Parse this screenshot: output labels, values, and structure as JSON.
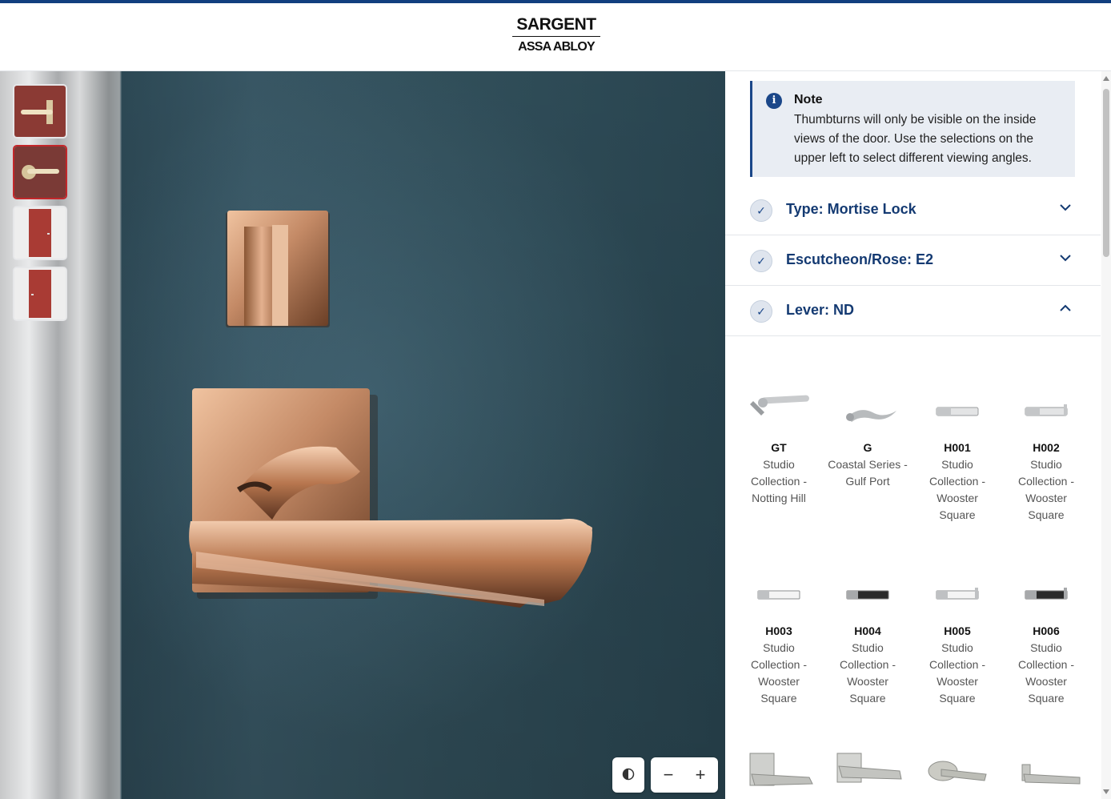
{
  "brand": {
    "top": "SARGENT",
    "bottom": "ASSA ABLOY"
  },
  "viewer": {
    "thumbnails": [
      {
        "name": "thumb-lever-closeup-outside",
        "active": false
      },
      {
        "name": "thumb-lever-closeup-inside",
        "active": true
      },
      {
        "name": "thumb-door-full-outside",
        "active": false
      },
      {
        "name": "thumb-door-full-inside",
        "active": false
      }
    ],
    "controls": {
      "contrast_icon": "contrast-icon",
      "zoom_out": "−",
      "zoom_in": "+"
    }
  },
  "note": {
    "title": "Note",
    "body": "Thumbturns will only be visible on the inside views of the door. Use the selections on the upper left to select different viewing angles.",
    "icon": "info-icon"
  },
  "accordions": [
    {
      "label": "Type: Mortise Lock",
      "expanded": false
    },
    {
      "label": "Escutcheon/Rose: E2",
      "expanded": false
    },
    {
      "label": "Lever: ND",
      "expanded": true
    }
  ],
  "levers": [
    {
      "code": "GT",
      "desc": "Studio Collection - Notting Hill"
    },
    {
      "code": "G",
      "desc": "Coastal Series - Gulf Port"
    },
    {
      "code": "H001",
      "desc": "Studio Collection - Wooster Square"
    },
    {
      "code": "H002",
      "desc": "Studio Collection - Wooster Square"
    },
    {
      "code": "H003",
      "desc": "Studio Collection - Wooster Square"
    },
    {
      "code": "H004",
      "desc": "Studio Collection - Wooster Square"
    },
    {
      "code": "H005",
      "desc": "Studio Collection - Wooster Square"
    },
    {
      "code": "H006",
      "desc": "Studio Collection - Wooster Square"
    }
  ],
  "colors": {
    "accent": "#123f7f",
    "active_thumb": "#c3272b",
    "door": "#34535f",
    "finish": "#c48a66"
  }
}
